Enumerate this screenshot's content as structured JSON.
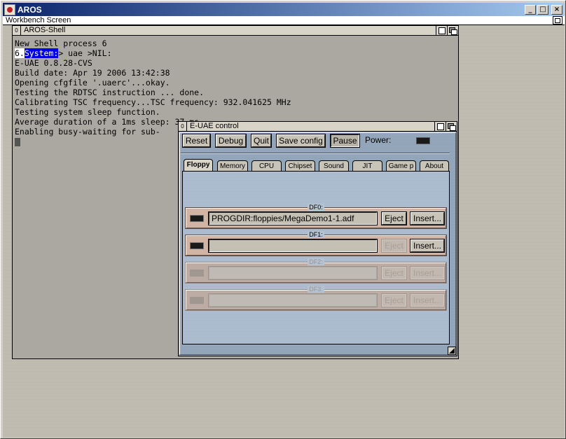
{
  "host_window": {
    "title": "AROS",
    "minimize_glyph": "_",
    "maximize_glyph": "□",
    "close_glyph": "×"
  },
  "screen": {
    "title": "Workbench Screen"
  },
  "shell": {
    "title": "AROS-Shell",
    "close_glyph": "0",
    "lines": [
      "New Shell process 6",
      "E-UAE 0.8.28-CVS",
      "Build date: Apr 19 2006 13:42:38",
      "Opening cfgfile '.uaerc'...okay.",
      "Testing the RDTSC instruction ... done.",
      "Calibrating TSC frequency...TSC frequency: 932.041625 MHz",
      "Testing system sleep function.",
      "Average duration of a 1ms sleep: 37 ms",
      "Enabling busy-waiting for sub-"
    ],
    "prompt_number": "6.",
    "prompt_path": "System:",
    "prompt_command": "> uae >NIL:"
  },
  "euae": {
    "title": "E-UAE control",
    "close_glyph": "0",
    "buttons": {
      "reset": "Reset",
      "debug": "Debug",
      "quit": "Quit",
      "save_config": "Save config",
      "pause": "Pause"
    },
    "power_label": "Power:",
    "tabs": [
      "Floppy",
      "Memory",
      "CPU",
      "Chipset",
      "Sound",
      "JIT",
      "Game p",
      "About"
    ],
    "active_tab": "Floppy",
    "drives": [
      {
        "label": "DF0:",
        "path": "PROGDIR:floppies/MegaDemo1-1.adf",
        "eject": "Eject",
        "insert": "Insert...",
        "enabled": true
      },
      {
        "label": "DF1:",
        "path": "",
        "eject": "Eject",
        "insert": "Insert...",
        "enabled": true
      },
      {
        "label": "DF2:",
        "path": "",
        "eject": "Eject",
        "insert": "Insert...",
        "enabled": false
      },
      {
        "label": "DF3:",
        "path": "",
        "eject": "Eject",
        "insert": "Insert...",
        "enabled": false
      }
    ]
  }
}
